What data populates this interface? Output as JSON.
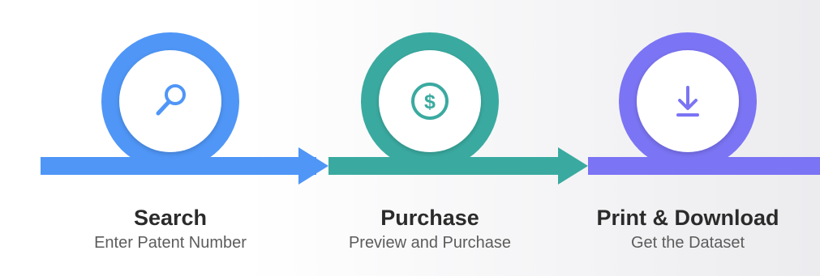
{
  "steps": [
    {
      "title": "Search",
      "subtitle": "Enter Patent Number",
      "icon": "search-icon",
      "color": "#4f96f7"
    },
    {
      "title": "Purchase",
      "subtitle": "Preview and Purchase",
      "icon": "dollar-icon",
      "color": "#3aaaa0"
    },
    {
      "title": "Print & Download",
      "subtitle": "Get the Dataset",
      "icon": "download-icon",
      "color": "#7b74f4"
    }
  ]
}
